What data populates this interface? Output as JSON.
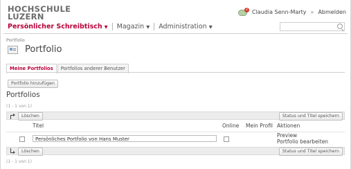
{
  "header": {
    "logo_line1": "HOCHSCHULE",
    "logo_line2": "LUZERN",
    "notifications_count": "2",
    "user_name": "Claudia Senn-Marty",
    "separator": "»",
    "logout": "Abmelden"
  },
  "nav": {
    "items": [
      {
        "label": "Persönlicher Schreibtisch",
        "caret": "▼"
      },
      {
        "label": "Magazin",
        "caret": "▼"
      },
      {
        "label": "Administration",
        "caret": "▼"
      }
    ]
  },
  "search": {
    "placeholder": ""
  },
  "breadcrumb": "Portfolio",
  "page_title": "Portfolio",
  "tabs": [
    {
      "label": "Meine Portfolios"
    },
    {
      "label": "Portfolios anderer Benutzer"
    }
  ],
  "add_button": "Portfolio hinzufügen",
  "section_title": "Portfolios",
  "pager_top": "(1 - 1 von 1)",
  "pager_bottom": "(1 - 1 von 1)",
  "toolbar": {
    "delete_label": "Löschen",
    "save_label": "Status und Titel speichern"
  },
  "table": {
    "columns": [
      "Titel",
      "Online",
      "Mein Profil",
      "Aktionen"
    ],
    "rows": [
      {
        "title": "Persönliches Portfolio von Hans Muster",
        "online": false,
        "actions": [
          "Preview",
          "Portfolio bearbeiten"
        ]
      }
    ]
  }
}
